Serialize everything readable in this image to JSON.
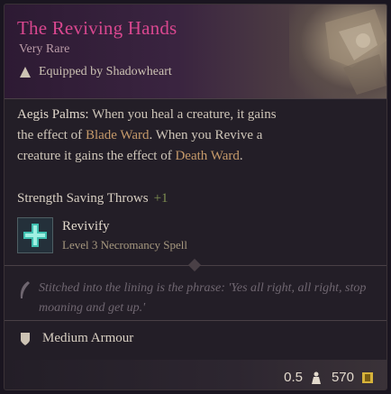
{
  "item": {
    "name": "The Reviving Hands",
    "rarity": "Very Rare",
    "equipped_by": "Equipped by Shadowheart",
    "rarity_color": "#d9478f"
  },
  "description": {
    "ability_name": "Aegis Palms:",
    "part1": " When you heal a creature, it gains the effect of ",
    "blade_ward": "Blade Ward",
    "part2": ". When you Revive a creature it gains the effect of ",
    "death_ward": "Death Ward",
    "part3": "."
  },
  "bonus": {
    "label": "Strength Saving Throws",
    "value": "+1"
  },
  "spell": {
    "name": "Revivify",
    "level": "Level 3 Necromancy Spell",
    "icon": "revivify-cross-icon"
  },
  "flavor": {
    "text": "Stitched into the lining is the phrase: 'Yes all right, all right, stop moaning and get up.'",
    "icon": "quill-icon"
  },
  "armour": {
    "label": "Medium Armour",
    "icon": "armour-icon"
  },
  "footer": {
    "weight": "0.5",
    "weight_icon": "weight-icon",
    "value": "570",
    "gold_icon": "gold-coin-icon"
  }
}
